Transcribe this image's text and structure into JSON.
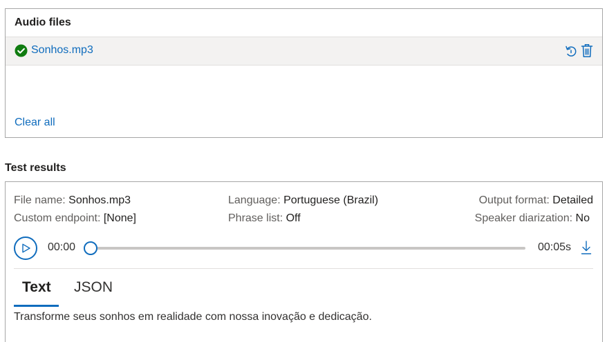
{
  "audio_files": {
    "title": "Audio files",
    "files": [
      {
        "name": "Sonhos.mp3",
        "status": "success"
      }
    ],
    "clear_all_label": "Clear all"
  },
  "test_results": {
    "title": "Test results",
    "file_name": {
      "label": "File name:",
      "value": "Sonhos.mp3"
    },
    "custom_endpoint": {
      "label": "Custom endpoint:",
      "value": "[None]"
    },
    "language": {
      "label": "Language:",
      "value": "Portuguese (Brazil)"
    },
    "phrase_list": {
      "label": "Phrase list:",
      "value": "Off"
    },
    "output_format": {
      "label": "Output format:",
      "value": "Detailed"
    },
    "speaker_diarization": {
      "label": "Speaker diarization:",
      "value": "No"
    },
    "player": {
      "current_time": "00:00",
      "total_time": "00:05s",
      "progress": 0
    },
    "tabs": [
      {
        "label": "Text",
        "selected": true
      },
      {
        "label": "JSON",
        "selected": false
      }
    ],
    "transcript": "Transforme seus sonhos em realidade com nossa inovação e dedicação."
  },
  "colors": {
    "accent": "#0f6cbd",
    "success": "#107c10",
    "border": "#a6a6a6"
  }
}
